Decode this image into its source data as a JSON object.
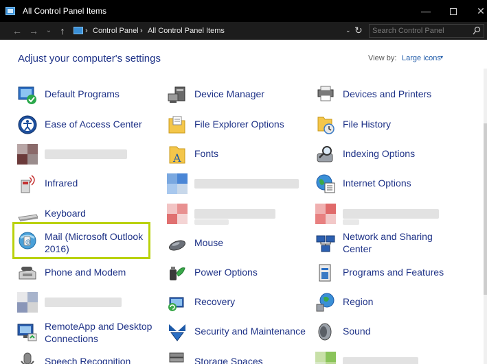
{
  "window": {
    "title": "All Control Panel Items",
    "minimize_symbol": "—",
    "maximize_symbol": "",
    "close_symbol": "✕"
  },
  "address": {
    "back_symbol": "←",
    "forward_symbol": "→",
    "recent_symbol": "⌄",
    "up_symbol": "↑",
    "crumbs": [
      "Control Panel",
      "All Control Panel Items"
    ],
    "separator": "›",
    "dropdown_symbol": "⌄",
    "refresh_symbol": "↻",
    "search_placeholder": "Search Control Panel"
  },
  "header": {
    "title": "Adjust your computer's settings",
    "view_by_label": "View by:",
    "view_by_value": "Large icons",
    "view_by_caret": "▾"
  },
  "columns": [
    [
      {
        "label": "Default Programs",
        "icon": "default-programs-icon"
      },
      {
        "label": "Ease of Access Center",
        "icon": "ease-of-access-icon"
      },
      {
        "label": "",
        "icon": "redacted-icon",
        "blurred": true
      },
      {
        "label": "Infrared",
        "icon": "infrared-icon"
      },
      {
        "label": "Keyboard",
        "icon": "keyboard-icon"
      },
      {
        "label": "Mail (Microsoft Outlook 2016)",
        "icon": "mail-icon",
        "selected": true
      },
      {
        "label": "Phone and Modem",
        "icon": "phone-modem-icon"
      },
      {
        "label": "",
        "icon": "redacted-icon",
        "blurred": true
      },
      {
        "label": "RemoteApp and Desktop Connections",
        "icon": "remoteapp-icon"
      },
      {
        "label": "Speech Recognition",
        "icon": "speech-icon"
      }
    ],
    [
      {
        "label": "Device Manager",
        "icon": "device-manager-icon"
      },
      {
        "label": "File Explorer Options",
        "icon": "file-explorer-options-icon"
      },
      {
        "label": "Fonts",
        "icon": "fonts-icon"
      },
      {
        "label": "",
        "icon": "redacted-icon",
        "blurred": true
      },
      {
        "label": "",
        "icon": "redacted-icon",
        "blurred": true
      },
      {
        "label": "Mouse",
        "icon": "mouse-icon"
      },
      {
        "label": "Power Options",
        "icon": "power-options-icon"
      },
      {
        "label": "Recovery",
        "icon": "recovery-icon"
      },
      {
        "label": "Security and Maintenance",
        "icon": "security-maintenance-icon"
      },
      {
        "label": "Storage Spaces",
        "icon": "storage-spaces-icon"
      }
    ],
    [
      {
        "label": "Devices and Printers",
        "icon": "devices-printers-icon"
      },
      {
        "label": "File History",
        "icon": "file-history-icon"
      },
      {
        "label": "Indexing Options",
        "icon": "indexing-options-icon"
      },
      {
        "label": "Internet Options",
        "icon": "internet-options-icon"
      },
      {
        "label": "",
        "icon": "redacted-icon",
        "blurred": true
      },
      {
        "label": "Network and Sharing Center",
        "icon": "network-sharing-icon"
      },
      {
        "label": "Programs and Features",
        "icon": "programs-features-icon"
      },
      {
        "label": "Region",
        "icon": "region-icon"
      },
      {
        "label": "Sound",
        "icon": "sound-icon"
      },
      {
        "label": "",
        "icon": "redacted-icon",
        "blurred": true
      }
    ]
  ],
  "colors": {
    "link": "#1e3287",
    "selection": "#b9d10a",
    "titlebar": "#000000"
  }
}
